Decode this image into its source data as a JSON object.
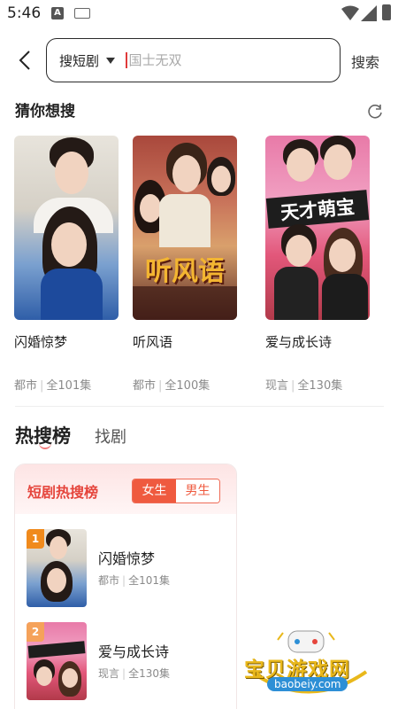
{
  "status_bar": {
    "time": "5:46",
    "a_indicator": "A"
  },
  "search": {
    "category": "搜短剧",
    "placeholder": "国士无双",
    "search_label": "搜索"
  },
  "guess": {
    "title": "猜你想搜",
    "items": [
      {
        "title": "闪婚惊梦",
        "genre": "都市",
        "episodes": "全101集",
        "poster_text": ""
      },
      {
        "title": "听风语",
        "genre": "都市",
        "episodes": "全100集",
        "poster_text": "听风语"
      },
      {
        "title": "爱与成长诗",
        "genre": "现言",
        "episodes": "全130集",
        "poster_text": "天才萌宝"
      }
    ]
  },
  "tabs": [
    {
      "label": "热搜榜",
      "active": true
    },
    {
      "label": "找剧",
      "active": false
    }
  ],
  "hot_panel": {
    "title": "短剧热搜榜",
    "gender_options": [
      "女生",
      "男生"
    ],
    "items": [
      {
        "rank": "1",
        "title": "闪婚惊梦",
        "genre": "都市",
        "episodes": "全101集"
      },
      {
        "rank": "2",
        "title": "爱与成长诗",
        "genre": "现言",
        "episodes": "全130集"
      }
    ]
  },
  "separator": "|",
  "watermark": {
    "text": "宝贝游戏网",
    "url": "baobeiy.com"
  },
  "colors": {
    "accent_red": "#e5453c",
    "toggle_active": "#ef5a3f",
    "rank1": "#f08a1c",
    "rank2": "#f5a25a"
  }
}
